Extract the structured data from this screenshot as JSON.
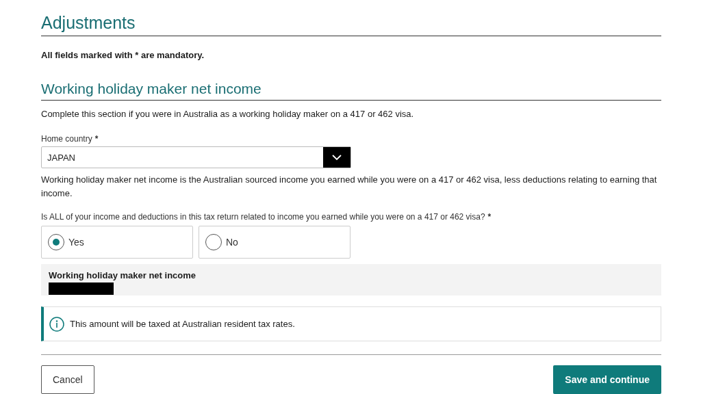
{
  "page_title": "Adjustments",
  "mandatory_note": "All fields marked with * are mandatory.",
  "section": {
    "title": "Working holiday maker net income",
    "intro": "Complete this section if you were in Australia as a working holiday maker on a 417 or 462 visa.",
    "home_country": {
      "label": "Home country",
      "required_mark": "*",
      "value": "JAPAN"
    },
    "description": "Working holiday maker net income is the Australian sourced income you earned while you were on a 417 or 462 visa, less deductions relating to earning that income.",
    "question": {
      "label": "Is ALL of your income and deductions in this tax return related to income you earned while you were on a 417 or 462 visa?",
      "required_mark": "*",
      "options": [
        {
          "label": "Yes",
          "selected": true
        },
        {
          "label": "No",
          "selected": false
        }
      ]
    },
    "result": {
      "label": "Working holiday maker net income",
      "redacted": true
    },
    "info": "This amount will be taxed at Australian resident tax rates."
  },
  "buttons": [
    {
      "kind": "secondary",
      "label": "Cancel"
    },
    {
      "kind": "primary",
      "label": "Save and continue"
    }
  ]
}
